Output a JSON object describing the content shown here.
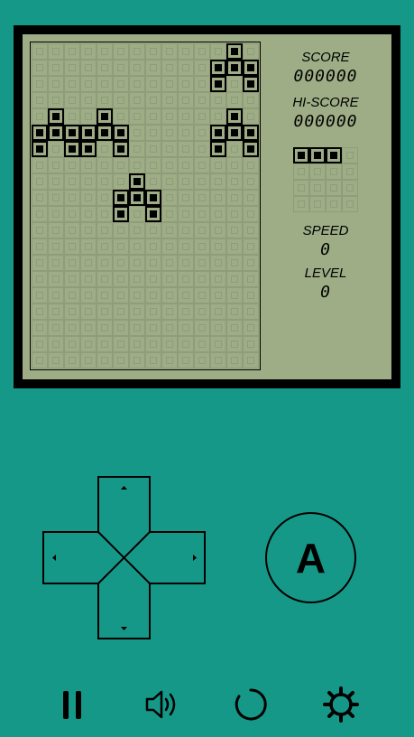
{
  "labels": {
    "score": "SCORE",
    "score_value": "000000",
    "hiscore": "HI-SCORE",
    "hiscore_value": "000000",
    "speed": "SPEED",
    "speed_value": "0",
    "level": "LEVEL",
    "level_value": "0"
  },
  "buttons": {
    "a_label": "A"
  },
  "field": {
    "cols": 14,
    "rows": 20,
    "lit_cells": [
      [
        12,
        0
      ],
      [
        11,
        1
      ],
      [
        12,
        1
      ],
      [
        13,
        1
      ],
      [
        11,
        2
      ],
      [
        13,
        2
      ],
      [
        1,
        4
      ],
      [
        4,
        4
      ],
      [
        12,
        4
      ],
      [
        0,
        5
      ],
      [
        1,
        5
      ],
      [
        2,
        5
      ],
      [
        3,
        5
      ],
      [
        4,
        5
      ],
      [
        5,
        5
      ],
      [
        11,
        5
      ],
      [
        12,
        5
      ],
      [
        13,
        5
      ],
      [
        0,
        6
      ],
      [
        2,
        6
      ],
      [
        3,
        6
      ],
      [
        5,
        6
      ],
      [
        11,
        6
      ],
      [
        13,
        6
      ],
      [
        6,
        8
      ],
      [
        5,
        9
      ],
      [
        6,
        9
      ],
      [
        7,
        9
      ],
      [
        5,
        10
      ],
      [
        7,
        10
      ]
    ]
  },
  "next_piece": {
    "cols": 4,
    "rows": 4,
    "lit_cells": [
      [
        0,
        0
      ],
      [
        1,
        0
      ],
      [
        2,
        0
      ]
    ]
  },
  "toolbar": {
    "items": [
      "pause-icon",
      "sound-icon",
      "restart-icon",
      "settings-icon"
    ]
  },
  "colors": {
    "background": "#169889",
    "lcd": "#9ead86",
    "pixel_off": "#8f9d78",
    "pixel_on": "#000000"
  }
}
